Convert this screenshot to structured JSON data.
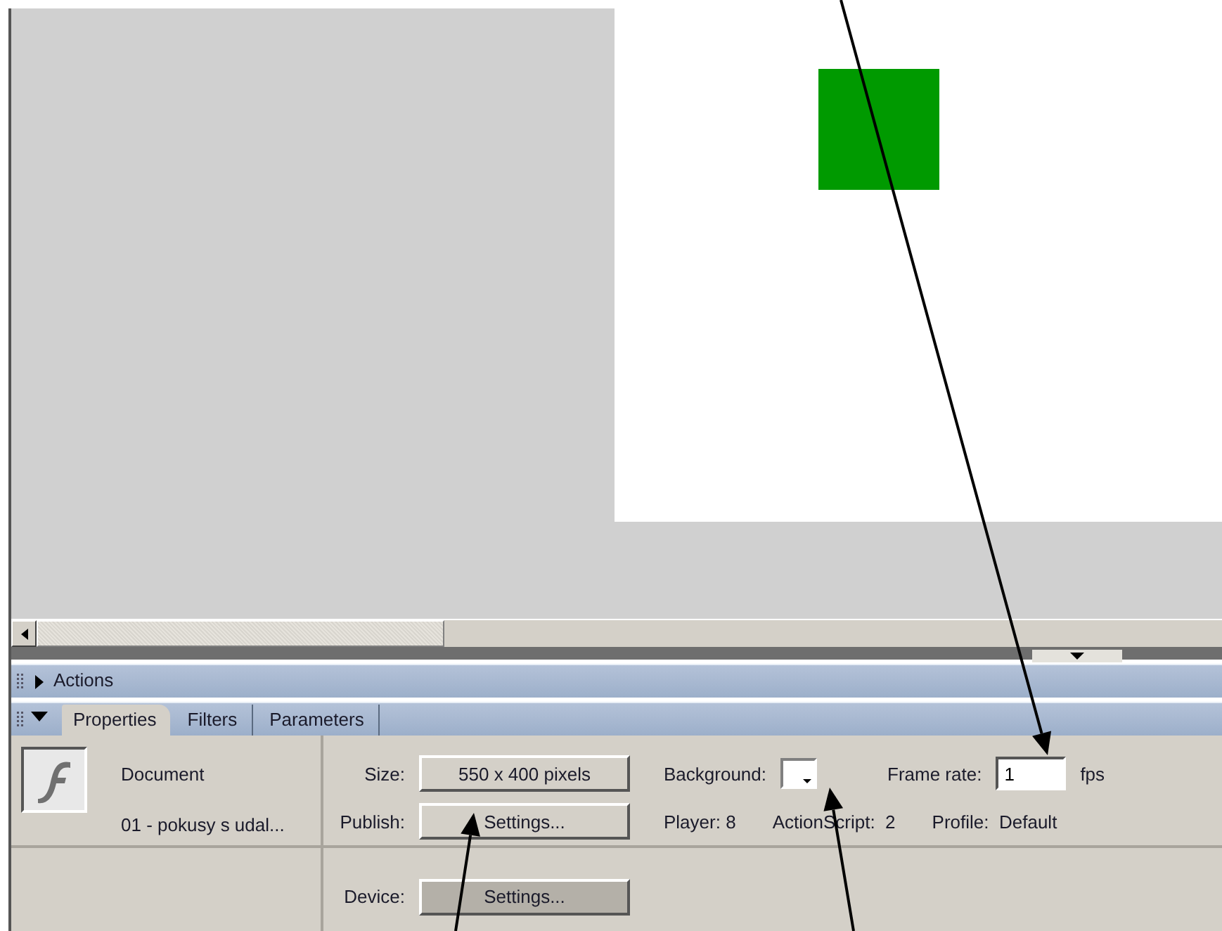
{
  "actions_panel": {
    "title": "Actions",
    "expanded": false
  },
  "properties_panel": {
    "expanded": true,
    "tabs": [
      {
        "label": "Properties",
        "selected": true
      },
      {
        "label": "Filters",
        "selected": false
      },
      {
        "label": "Parameters",
        "selected": false
      }
    ],
    "document": {
      "type": "Document",
      "name": "01 - pokusy s udal..."
    },
    "size": {
      "label": "Size:",
      "value": "550 x 400 pixels"
    },
    "publish": {
      "label": "Publish:",
      "button": "Settings..."
    },
    "device": {
      "label": "Device:",
      "button": "Settings...",
      "disabled": true
    },
    "background": {
      "label": "Background:"
    },
    "frame_rate": {
      "label": "Frame rate:",
      "value": "1",
      "unit": "fps"
    },
    "info": [
      {
        "label": "Player:",
        "value": "8"
      },
      {
        "label": "ActionScript:",
        "value": "2"
      },
      {
        "label": "Profile:",
        "value": "Default"
      }
    ]
  }
}
